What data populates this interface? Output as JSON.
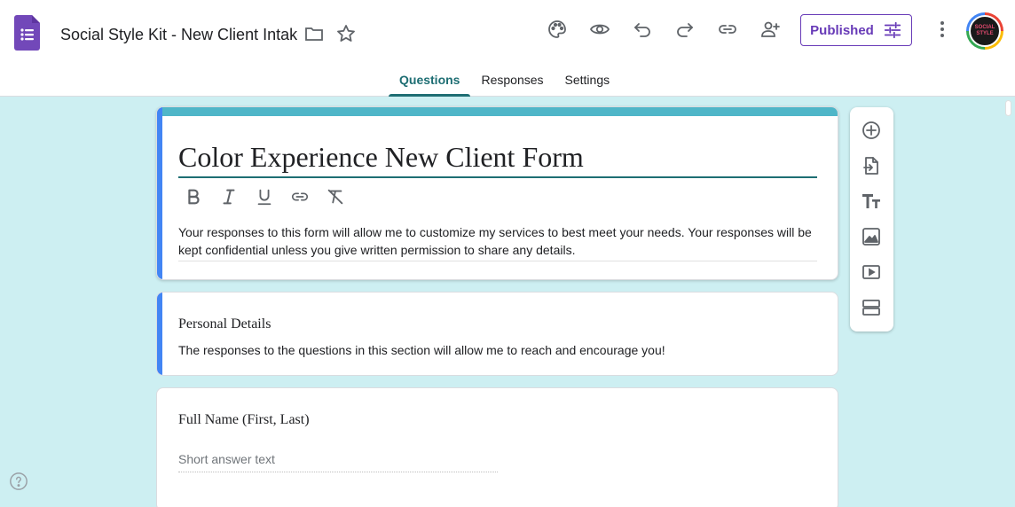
{
  "header": {
    "doc_title": "Social Style Kit - New Client Intake",
    "publish_label": "Published",
    "avatar_text": "SOCIAL STYLE"
  },
  "tabs": [
    {
      "label": "Questions",
      "active": true
    },
    {
      "label": "Responses",
      "active": false
    },
    {
      "label": "Settings",
      "active": false
    }
  ],
  "form": {
    "title": "Color Experience New Client Form",
    "description": "Your responses to this form will allow me to customize my services to best meet your needs. Your responses will be kept confidential unless you give written permission to share any details."
  },
  "section": {
    "title": "Personal Details",
    "description": "The responses to the questions in this section will allow me to reach and encourage you!"
  },
  "question": {
    "title": "Full Name (First, Last)",
    "answer_placeholder": "Short answer text"
  },
  "icons": {
    "toolbar": [
      "palette-icon",
      "eye-icon",
      "undo-icon",
      "redo-icon",
      "link-icon",
      "add-person-icon",
      "more-vert-icon"
    ],
    "format": [
      "bold-icon",
      "italic-icon",
      "underline-icon",
      "link-icon",
      "clear-format-icon"
    ],
    "side": [
      "add-question-icon",
      "import-questions-icon",
      "title-text-icon",
      "image-icon",
      "video-icon",
      "section-icon"
    ]
  },
  "colors": {
    "accent": "#1e6e73",
    "background": "#cdeff2",
    "header_stripe": "#4fb6c8",
    "left_accent": "#4285f4",
    "brand_purple": "#673ab7"
  }
}
